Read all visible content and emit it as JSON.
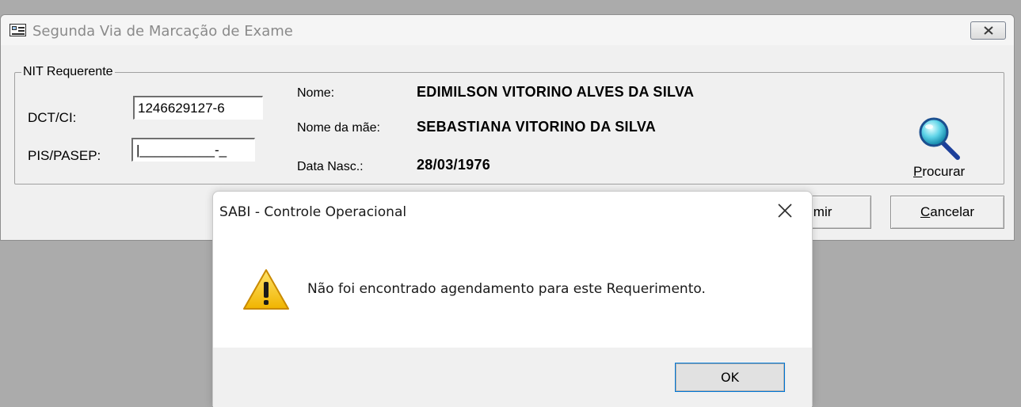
{
  "main_window": {
    "title": "Segunda Via de Marcação de Exame",
    "group_label": "NIT Requerente",
    "dct_label": "DCT/CI:",
    "dct_value": "1246629127-6",
    "pis_label": "PIS/PASEP:",
    "pis_value": "|__________-_",
    "nome_label": "Nome:",
    "nome_value": "EDIMILSON VITORINO ALVES DA SILVA",
    "mae_label": "Nome da mãe:",
    "mae_value": "SEBASTIANA VITORINO DA SILVA",
    "nasc_label": "Data Nasc.:",
    "nasc_value": "28/03/1976",
    "procurar_first": "P",
    "procurar_rest": "rocurar",
    "imprimir_partial": "imir",
    "cancelar_first": "C",
    "cancelar_rest": "ancelar"
  },
  "dialog": {
    "title": "SABI - Controle Operacional",
    "message": "Não foi encontrado agendamento para este Requerimento.",
    "ok_label": "OK"
  },
  "colors": {
    "desktop_bg": "#ababab",
    "window_bg": "#f0f0f0",
    "dialog_bg": "#ffffff",
    "focus_outline": "#0078d7",
    "warning_yellow": "#f5c400"
  },
  "icons": {
    "app": "form-card-icon",
    "search": "magnifier-icon",
    "warning": "warning-triangle-icon",
    "close": "close-icon"
  }
}
